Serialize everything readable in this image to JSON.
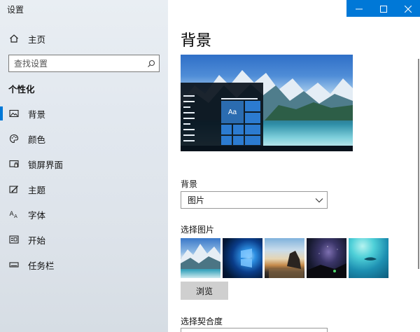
{
  "window": {
    "title": "设置",
    "controls": {
      "minimize_icon": "minimize-icon",
      "maximize_icon": "maximize-icon",
      "close_icon": "close-icon"
    },
    "accent_color": "#0078d7"
  },
  "sidebar": {
    "home_label": "主页",
    "search_placeholder": "查找设置",
    "section_title": "个性化",
    "items": [
      {
        "label": "背景",
        "icon": "picture-icon",
        "active": true
      },
      {
        "label": "颜色",
        "icon": "palette-icon",
        "active": false
      },
      {
        "label": "锁屏界面",
        "icon": "lock-screen-icon",
        "active": false
      },
      {
        "label": "主题",
        "icon": "theme-icon",
        "active": false
      },
      {
        "label": "字体",
        "icon": "font-icon",
        "active": false
      },
      {
        "label": "开始",
        "icon": "start-icon",
        "active": false
      },
      {
        "label": "任务栏",
        "icon": "taskbar-icon",
        "active": false
      }
    ]
  },
  "main": {
    "title": "背景",
    "preview": {
      "tile_text": "Aa"
    },
    "background_label": "背景",
    "background_value": "图片",
    "choose_picture_label": "选择图片",
    "browse_label": "浏览",
    "fit_label": "选择契合度"
  }
}
